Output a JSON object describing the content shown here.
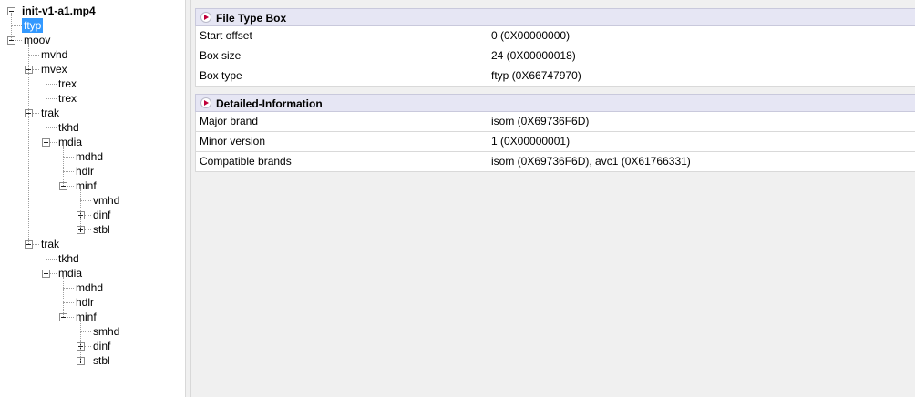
{
  "tree": {
    "root": "init-v1-a1.mp4",
    "nodes": [
      "ftyp",
      "moov",
      "mvhd",
      "mvex",
      "trex",
      "trex",
      "trak",
      "tkhd",
      "mdia",
      "mdhd",
      "hdlr",
      "minf",
      "vmhd",
      "dinf",
      "stbl",
      "trak",
      "tkhd",
      "mdia",
      "mdhd",
      "hdlr",
      "minf",
      "smhd",
      "dinf",
      "stbl"
    ],
    "selected": "ftyp"
  },
  "sections": [
    {
      "title": "File Type Box",
      "rows": [
        {
          "name": "Start offset",
          "value": "0 (0X00000000)"
        },
        {
          "name": "Box size",
          "value": "24 (0X00000018)"
        },
        {
          "name": "Box type",
          "value": "ftyp (0X66747970)"
        }
      ]
    },
    {
      "title": "Detailed-Information",
      "rows": [
        {
          "name": "Major brand",
          "value": "isom (0X69736F6D)"
        },
        {
          "name": "Minor version",
          "value": "1 (0X00000001)"
        },
        {
          "name": "Compatible brands",
          "value": "isom (0X69736F6D), avc1 (0X61766331)"
        }
      ]
    }
  ]
}
